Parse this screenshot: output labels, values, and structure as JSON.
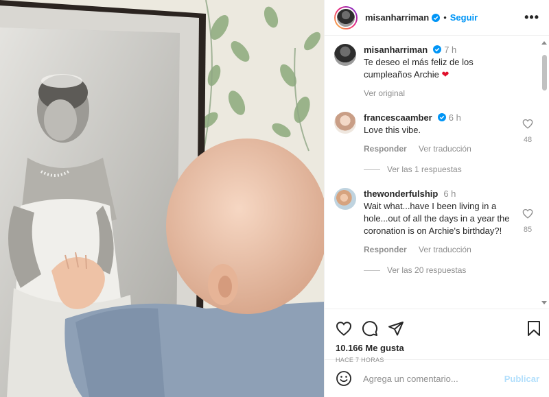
{
  "header": {
    "username": "misanharriman",
    "follow_label": "Seguir",
    "more_label": "•••"
  },
  "caption": {
    "username": "misanharriman",
    "time": "7 h",
    "text": "Te deseo el más feliz de los cumpleaños Archie",
    "emoji": "❤",
    "see_original": "Ver original"
  },
  "comments": [
    {
      "username": "francescaamber",
      "time": "6 h",
      "text": "Love this vibe.",
      "reply_label": "Responder",
      "translate_label": "Ver traducción",
      "likes": "48",
      "replies_label": "Ver las 1 respuestas"
    },
    {
      "username": "thewonderfulship",
      "time": "6 h",
      "text": "Wait what...have I been living in a hole...out of all the days in a year the coronation is on Archie's birthday?!",
      "reply_label": "Responder",
      "translate_label": "Ver traducción",
      "likes": "85",
      "replies_label": "Ver las 20 respuestas"
    }
  ],
  "actions": {
    "likes_text": "10.166 Me gusta",
    "time_ago": "HACE 7 HORAS"
  },
  "composer": {
    "placeholder": "Agrega un comentario...",
    "publish_label": "Publicar"
  },
  "colors": {
    "link_blue": "#0095f6",
    "verified_blue": "#0095f6",
    "heart_red": "#e0102b",
    "muted": "#8e8e8e",
    "publish_disabled": "#b2dffc"
  }
}
